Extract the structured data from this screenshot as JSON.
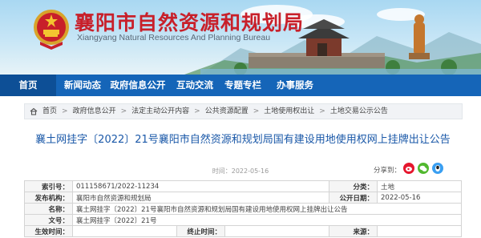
{
  "site": {
    "title": "襄阳市自然资源和规划局",
    "subtitle": "Xiangyang Natural Resources And Planning Bureau"
  },
  "nav": {
    "items": [
      "首页",
      "新闻动态",
      "政府信息公开",
      "互动交流",
      "专题专栏",
      "办事服务"
    ]
  },
  "breadcrumb": [
    "首页",
    "政府信息公开",
    "法定主动公开内容",
    "公共资源配置",
    "土地使用权出让",
    "土地交易公示公告"
  ],
  "article": {
    "title": "襄土网挂字〔2022〕21号襄阳市自然资源和规划局国有建设用地使用权网上挂牌出让公告",
    "date": "时间：2022-05-16",
    "share_label": "分享到："
  },
  "info": {
    "index_no_label": "索引号：",
    "index_no": "011158671/2022-11234",
    "category_label": "分类：",
    "category": "土地",
    "publisher_label": "发布机构：",
    "publisher": "襄阳市自然资源和规划局",
    "pub_date_label": "公开日期：",
    "pub_date": "2022-05-16",
    "name_label": "名称：",
    "name": "襄土网挂字〔2022〕21号襄阳市自然资源和规划局国有建设用地使用权网上挂牌出让公告",
    "doc_no_label": "文号：",
    "doc_no": "襄土网挂字〔2022〕21号",
    "effective_label": "生效时间：",
    "effective": "",
    "expire_label": "终止时间：",
    "expire": "",
    "source_label": "来源：",
    "source": ""
  },
  "colors": {
    "nav_bg": "#1565b8",
    "title_red": "#c8202a",
    "link_blue": "#1a58a8"
  }
}
